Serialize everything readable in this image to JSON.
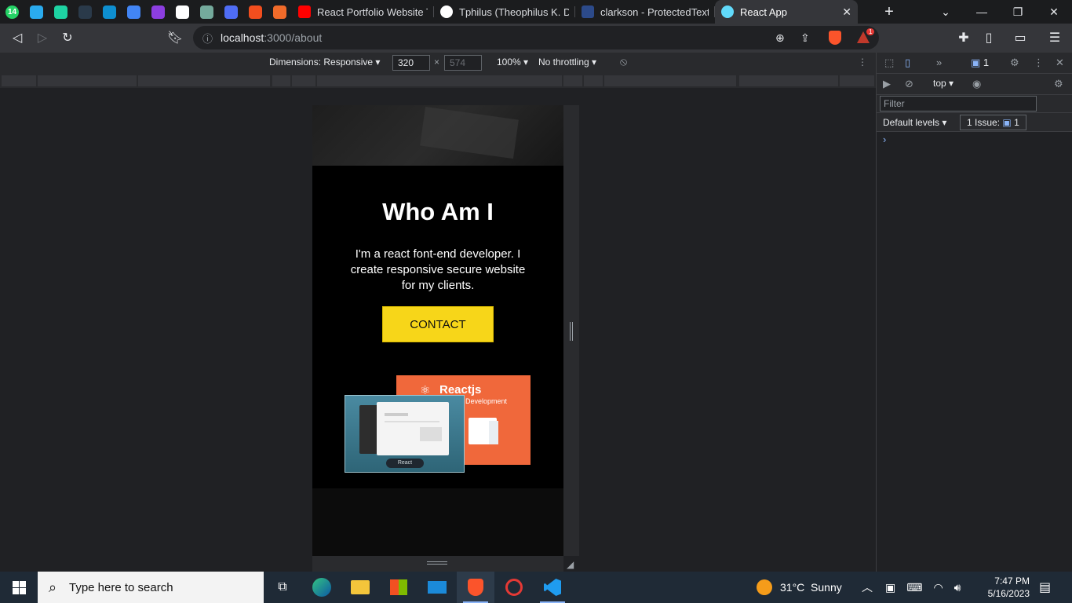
{
  "browser": {
    "pinned_tabs": [
      {
        "icon": "whatsapp-icon",
        "badge": "14",
        "color": "#25d366"
      },
      {
        "icon": "telegram-icon",
        "color": "#2aabee"
      },
      {
        "icon": "feather-icon",
        "color": "#1ed3a3"
      },
      {
        "icon": "x-app-icon",
        "color": "#2a3a4a"
      },
      {
        "icon": "play-icon",
        "color": "#0e8fd0"
      },
      {
        "icon": "document-icon",
        "color": "#4285f4"
      },
      {
        "icon": "u-icon",
        "color": "#8c3ee0"
      },
      {
        "icon": "page-icon",
        "color": "#ffffff"
      },
      {
        "icon": "chatgpt-icon",
        "color": "#74aa9c"
      },
      {
        "icon": "bars-icon",
        "color": "#4f6df5"
      },
      {
        "icon": "figma-icon",
        "color": "#f24e1e"
      },
      {
        "icon": "b-icon",
        "color": "#f16b2a"
      }
    ],
    "tabs": [
      {
        "title": "React Portfolio Website Tut",
        "icon": "youtube-icon",
        "color": "#ff0000"
      },
      {
        "title": "Tphilus (Theophilus K. Dadz",
        "icon": "github-icon",
        "color": "#ffffff"
      },
      {
        "title": "clarkson - ProtectedText",
        "icon": "pt-icon",
        "color": "#2c4a8a"
      },
      {
        "title": "React App",
        "icon": "react-icon",
        "color": "#61dafb",
        "active": true
      }
    ],
    "url_host": "localhost",
    "url_path": ":3000/about",
    "brave_badge": "1"
  },
  "devtools_bar": {
    "dimensions_label": "Dimensions: Responsive",
    "width": "320",
    "height": "574",
    "zoom": "100%",
    "throttling": "No throttling"
  },
  "devtools_panel": {
    "issues_count": "1",
    "context": "top",
    "filter_placeholder": "Filter",
    "levels": "Default levels",
    "issue_label": "1 Issue:",
    "issue_count": "1"
  },
  "page": {
    "title": "Who Am I",
    "text": "I'm a react font-end developer. I create responsive secure website for my clients.",
    "contact_label": "CONTACT",
    "image_react_title": "Reactjs",
    "image_react_subtitle": "Development",
    "image_pill": "React"
  },
  "taskbar": {
    "search_placeholder": "Type here to search",
    "weather": "31°C  Sunny",
    "time": "7:47 PM",
    "date": "5/16/2023"
  }
}
